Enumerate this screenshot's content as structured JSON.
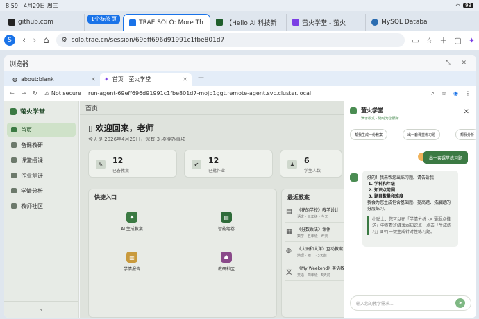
{
  "status": {
    "time": "8:59",
    "date": "4月29日 周三",
    "battery": "93"
  },
  "outer_tabs": [
    {
      "label": "github.com",
      "color": "#222222"
    },
    {
      "label": "TRAE SOLO: More Th",
      "color": "#1a73e8"
    },
    {
      "label": "【Hello AI 科技新",
      "color": "#1f5e2c"
    },
    {
      "label": "萤火学堂 - 萤火",
      "color": "#7b3fe4"
    },
    {
      "label": "MySQL Databas",
      "color": "#2b6cb0"
    }
  ],
  "tab_group": "1个标签页",
  "outer_url": "solo.trae.cn/session/69eff696d91991c1fbe801d7",
  "profile_initial": "S",
  "inner": {
    "window_title": "浏览器",
    "tabs": [
      {
        "label": "about:blank"
      },
      {
        "label": "首页 · 萤火学堂"
      }
    ],
    "not_secure": "Not secure",
    "url": "run-agent-69eff696d91991c1fbe801d7-mojb1ggt.remote-agent.svc.cluster.local"
  },
  "app": {
    "brand": "萤火学堂",
    "nav": [
      "首页",
      "备课教研",
      "课堂授课",
      "作业测评",
      "学情分析",
      "教师社区"
    ],
    "collapse": "‹",
    "header": "首页",
    "welcome": "欢迎回来，老师",
    "welcome_sub": "今天是 2026年4月29日，您有 3 项待办事项",
    "stats": [
      {
        "num": "12",
        "label": "已备教案"
      },
      {
        "num": "12",
        "label": "已批作业"
      },
      {
        "num": "6",
        "label": "学生人数"
      }
    ],
    "quick_title": "快捷入口",
    "quick": [
      "AI 生成教案",
      "智能组卷",
      "学情报告",
      "教研社区"
    ],
    "recent_title": "最近教案",
    "recent": [
      {
        "title": "《花的学校》教学设计",
        "meta": "语文 · 三年级 · 今天"
      },
      {
        "title": "《分数乘法》课件",
        "meta": "数学 · 五年级 · 昨天"
      },
      {
        "title": "《大洲和大洋》互动教案",
        "meta": "地理 · 初一 · 3天前"
      },
      {
        "title": "《My Weekend》英语教案",
        "meta": "英语 · 四年级 · 5天前"
      }
    ]
  },
  "chat": {
    "title": "萤火学堂",
    "subtitle": "演示模式 · 随时为您服务",
    "chips": [
      "帮我生成一份教案",
      "出一套课堂练习题",
      "帮我分析"
    ],
    "user_msg": "出一套课堂练习题",
    "bot_intro": "好的！我来帮您出练习题。请告诉我：",
    "bot_list": [
      "学科和年级",
      "知识点范围",
      "题目数量和难度"
    ],
    "bot_follow": "我会为您生成包含基础题、提高题、拓展题的分层练习。",
    "bot_tip": "小贴士：您可以在「学情分析 -> 薄弱点推送」中查看班级薄弱知识点，点击「生成练习」即可一键生成针对性练习题。",
    "input_placeholder": "输入您的教学需求..."
  }
}
